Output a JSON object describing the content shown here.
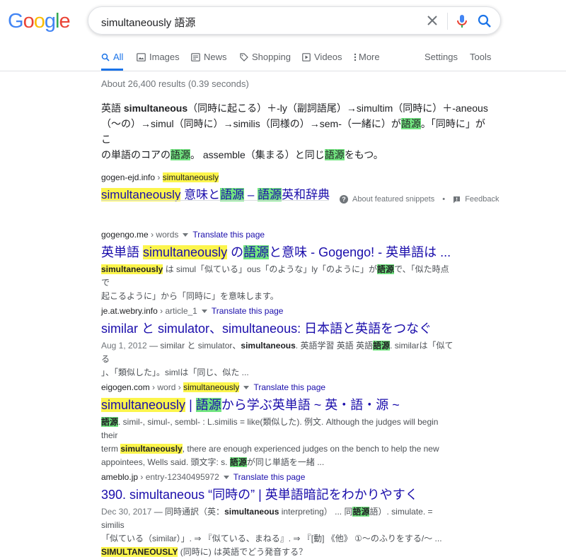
{
  "logo": {
    "text": "Google"
  },
  "search": {
    "query": "simultaneously 語源"
  },
  "tabs": [
    {
      "label": "All",
      "icon": "search-icon"
    },
    {
      "label": "Images",
      "icon": "image-icon"
    },
    {
      "label": "News",
      "icon": "news-icon"
    },
    {
      "label": "Shopping",
      "icon": "tag-icon"
    },
    {
      "label": "Videos",
      "icon": "play-icon"
    },
    {
      "label": "More",
      "icon": "more-vert-icon"
    },
    {
      "label": "Settings"
    },
    {
      "label": "Tools"
    }
  ],
  "stats": "About 26,400 results (0.39 seconds)",
  "snippet": {
    "l1a": "英語 ",
    "l1b": "simultaneous",
    "l1c": "（同時に起こる）＋-ly（副詞語尾）→simultim（同時に）＋-aneous",
    "l2a": "（〜の）→simul（同時に）→similis（同様の）→sem-（一緒に）が",
    "l2b": "語源",
    "l2c": "。「同時に」がこ",
    "l3a": "の単語のコアの",
    "l3b": "語源",
    "l3c": "。 assemble（集まる）と同じ",
    "l3d": "語源",
    "l3e": "をもつ。",
    "cite_domain": "gogen-ejd.info",
    "cite_path": "simultaneously",
    "title_a": "simultaneously",
    "title_b": " 意味と",
    "title_c": "語源",
    "title_d": " – ",
    "title_e": "語源",
    "title_f": "英和辞典",
    "about": "About featured snippets",
    "dot": "•",
    "feedback": "Feedback"
  },
  "results": [
    {
      "domain": "gogengo.me",
      "path": " › words",
      "translate": "Translate this page",
      "title_a": "英単語 ",
      "title_b": "simultaneously",
      "title_c": " の",
      "title_d": "語源",
      "title_e": "と意味 - Gogengo! - 英単語は ...",
      "d1a": "simultaneously",
      "d1b": " は simul「似ている」ous「のような」ly「のように」が",
      "d1c": "語源",
      "d1d": "で、「似た時点で",
      "d2": "起こるように」から「同時に」を意味します。"
    },
    {
      "domain": "je.at.webry.info",
      "path": " › article_1",
      "translate": "Translate this page",
      "title": "similar と simulator、simultaneous: 日本語と英語をつなぐ",
      "d1a": "Aug 1, 2012",
      "d1b": " — similar と simulator、",
      "d1c": "simultaneous",
      "d1d": ". 英語学習 英語 英語",
      "d1e": "語源",
      "d1f": ". similarは「似てる",
      "d2": "」、「類似した」。simlは「同じ、似た ..."
    },
    {
      "domain": "eigogen.com",
      "path": " › word › ",
      "path_hl": "simultaneously",
      "translate": "Translate this page",
      "title_a": "simultaneously",
      "title_b": " | ",
      "title_c": "語源",
      "title_d": "から学ぶ英単語 ~ 英・語・源 ~",
      "d1a": "語源",
      "d1b": ". simil-, simul-, sembl- : L.similis = like(類似した). 例文. Although the judges will begin their",
      "d2a": "term ",
      "d2b": "simultaneously",
      "d2c": ", there are enough experienced judges on the bench to help the new",
      "d3a": "appointees, Wells said. 頭文字: s. ",
      "d3b": "語源",
      "d3c": "が同じ単語を一緒 ..."
    },
    {
      "domain": "ameblo.jp",
      "path": " › entry-12340495972",
      "translate": "Translate this page",
      "title": "390. simultaneous “同時の” | 英単語暗記をわかりやすく",
      "d1a": "Dec 30, 2017",
      "d1b": " — 同時通訳（英：",
      "d1c": "simultaneous",
      "d1d": " interpreting） ... 同",
      "d1e": "語源",
      "d1f": "語）. simulate. = similis",
      "d2": "「似ている（similar）」. ⇒ 『似ている、まねる』. ⇒ 『[動] 《他》 ①〜のふりをする/〜 ...",
      "d3a": "SIMULTANEOUSLY",
      "d3b": " (同時に) は英語でどう発音する？"
    }
  ],
  "colors": {
    "link": "#1a0dab",
    "accent": "#1a73e8",
    "hl_green": "#72e580",
    "hl_yellow": "#fcf54c"
  }
}
